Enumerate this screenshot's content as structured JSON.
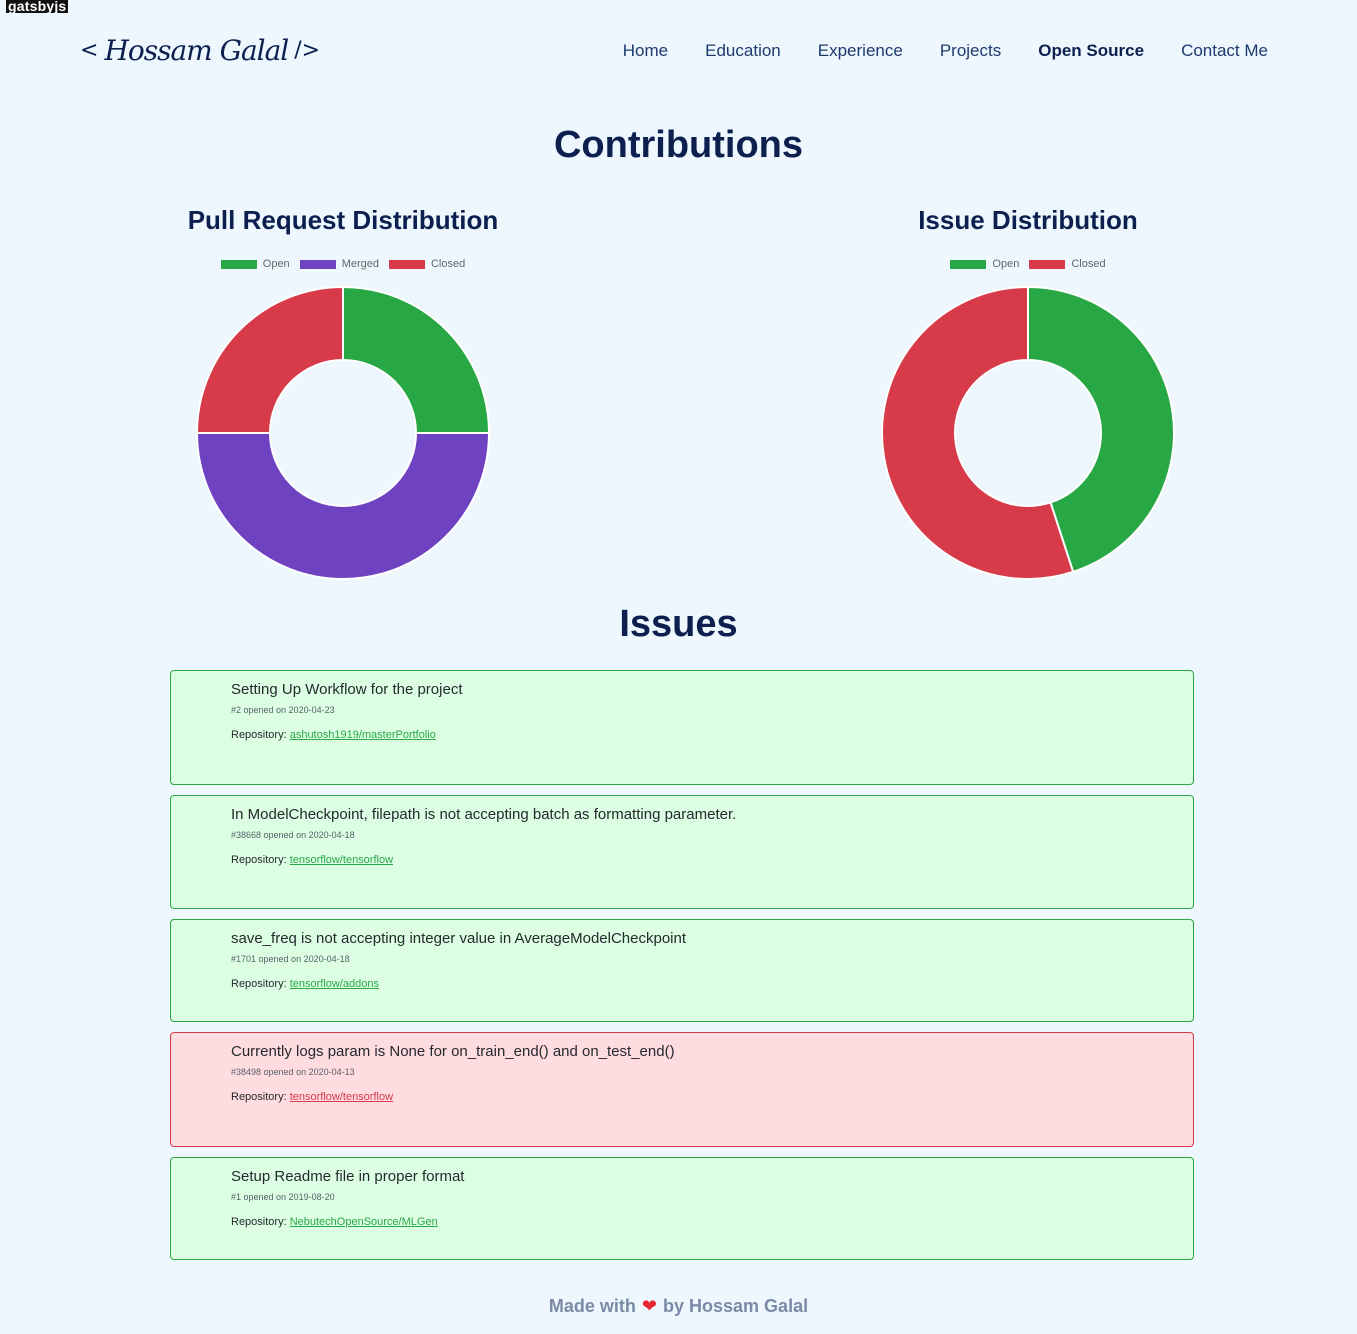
{
  "badge": "gatsbyjs",
  "logo": {
    "open": "<",
    "signature": "Hossam Galal",
    "close": "/>"
  },
  "nav": [
    {
      "label": "Home"
    },
    {
      "label": "Education"
    },
    {
      "label": "Experience"
    },
    {
      "label": "Projects"
    },
    {
      "label": "Open Source",
      "active": true
    },
    {
      "label": "Contact Me"
    }
  ],
  "contributions_title": "Contributions",
  "chart_data": [
    {
      "type": "pie",
      "title": "Pull Request Distribution",
      "categories": [
        "Open",
        "Merged",
        "Closed"
      ],
      "values": [
        6,
        12,
        6
      ],
      "colors": [
        "#28a745",
        "#6f42c1",
        "#d73a49"
      ],
      "donut": true,
      "legend": "top"
    },
    {
      "type": "pie",
      "title": "Issue Distribution",
      "categories": [
        "Open",
        "Closed"
      ],
      "values": [
        4.5,
        5.5
      ],
      "colors": [
        "#28a745",
        "#d73a49"
      ],
      "donut": true,
      "legend": "top"
    }
  ],
  "issues_title": "Issues",
  "issues": [
    {
      "title": "Setting Up Workflow for the project",
      "meta": "#2 opened on 2020-04-23",
      "repo_label": "Repository: ",
      "repo": "ashutosh1919/masterPortfolio",
      "state": "open"
    },
    {
      "title": "In ModelCheckpoint, filepath is not accepting batch as formatting parameter.",
      "meta": "#38668 opened on 2020-04-18",
      "repo_label": "Repository: ",
      "repo": "tensorflow/tensorflow",
      "state": "open"
    },
    {
      "title": "save_freq is not accepting integer value in AverageModelCheckpoint",
      "meta": "#1701 opened on 2020-04-18",
      "repo_label": "Repository: ",
      "repo": "tensorflow/addons",
      "state": "open"
    },
    {
      "title": "Currently logs param is None for on_train_end() and on_test_end()",
      "meta": "#38498 opened on 2020-04-13",
      "repo_label": "Repository: ",
      "repo": "tensorflow/tensorflow",
      "state": "closed"
    },
    {
      "title": "Setup Readme file in proper format",
      "meta": "#1 opened on 2019-08-20",
      "repo_label": "Repository: ",
      "repo": "NebutechOpenSource/MLGen",
      "state": "open"
    }
  ],
  "footer": {
    "made_with": "Made with",
    "heart": "❤",
    "by": "by Hossam Galal"
  }
}
